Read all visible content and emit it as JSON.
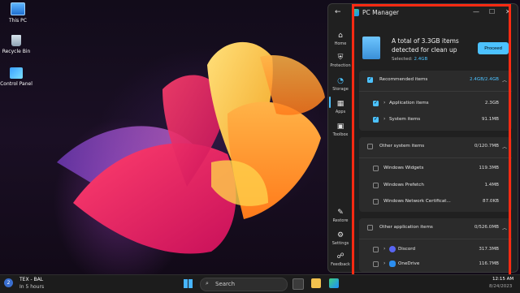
{
  "desktop": {
    "icons": [
      {
        "label": "This PC",
        "icon": "computer-icon"
      },
      {
        "label": "Recycle Bin",
        "icon": "recycle-bin-icon"
      },
      {
        "label": "Control Panel",
        "icon": "control-panel-icon"
      }
    ]
  },
  "window": {
    "title": "PC Manager",
    "back_icon": "←",
    "minimize_icon": "—",
    "maximize_icon": "☐",
    "close_icon": "✕"
  },
  "sidebar": {
    "items": [
      {
        "label": "Home",
        "icon": "⌂"
      },
      {
        "label": "Protection",
        "icon": "⛨"
      },
      {
        "label": "Storage",
        "icon": "◔",
        "active": true
      },
      {
        "label": "Apps",
        "icon": "▦"
      },
      {
        "label": "Toolbox",
        "icon": "▣"
      },
      {
        "label": "Restore",
        "icon": "✎"
      },
      {
        "label": "Settings",
        "icon": "⚙"
      },
      {
        "label": "Feedback",
        "icon": "☍"
      }
    ]
  },
  "cleanup": {
    "title": "A total of 3.3GB items detected for clean up",
    "selected_label": "Selected:",
    "selected_value": "2.4GB",
    "proceed_label": "Proceed"
  },
  "groups": {
    "recommended": {
      "label": "Recommended items",
      "size": "2.4GB/2.4GB",
      "items": [
        {
          "label": "Application items",
          "size": "2.3GB"
        },
        {
          "label": "System items",
          "size": "91.1MB"
        }
      ]
    },
    "other_system": {
      "label": "Other system items",
      "size": "0/120.7MB",
      "items": [
        {
          "label": "Windows Widgets",
          "size": "119.3MB"
        },
        {
          "label": "Windows Prefetch",
          "size": "1.4MB"
        },
        {
          "label": "Windows Network Certificat...",
          "size": "87.0KB"
        }
      ]
    },
    "other_app": {
      "label": "Other application items",
      "size": "0/526.0MB",
      "items": [
        {
          "label": "Discord",
          "size": "317.3MB"
        },
        {
          "label": "OneDrive",
          "size": "116.7MB"
        }
      ]
    }
  },
  "taskbar": {
    "weather_line1": "TEX - BAL",
    "weather_line2": "In 5 hours",
    "weather_badge": "2",
    "search_placeholder": "Search",
    "time": "12:15 AM",
    "date": "8/24/2023"
  },
  "colors": {
    "accent": "#4cc2ff",
    "highlight_box": "#ff2a12"
  }
}
